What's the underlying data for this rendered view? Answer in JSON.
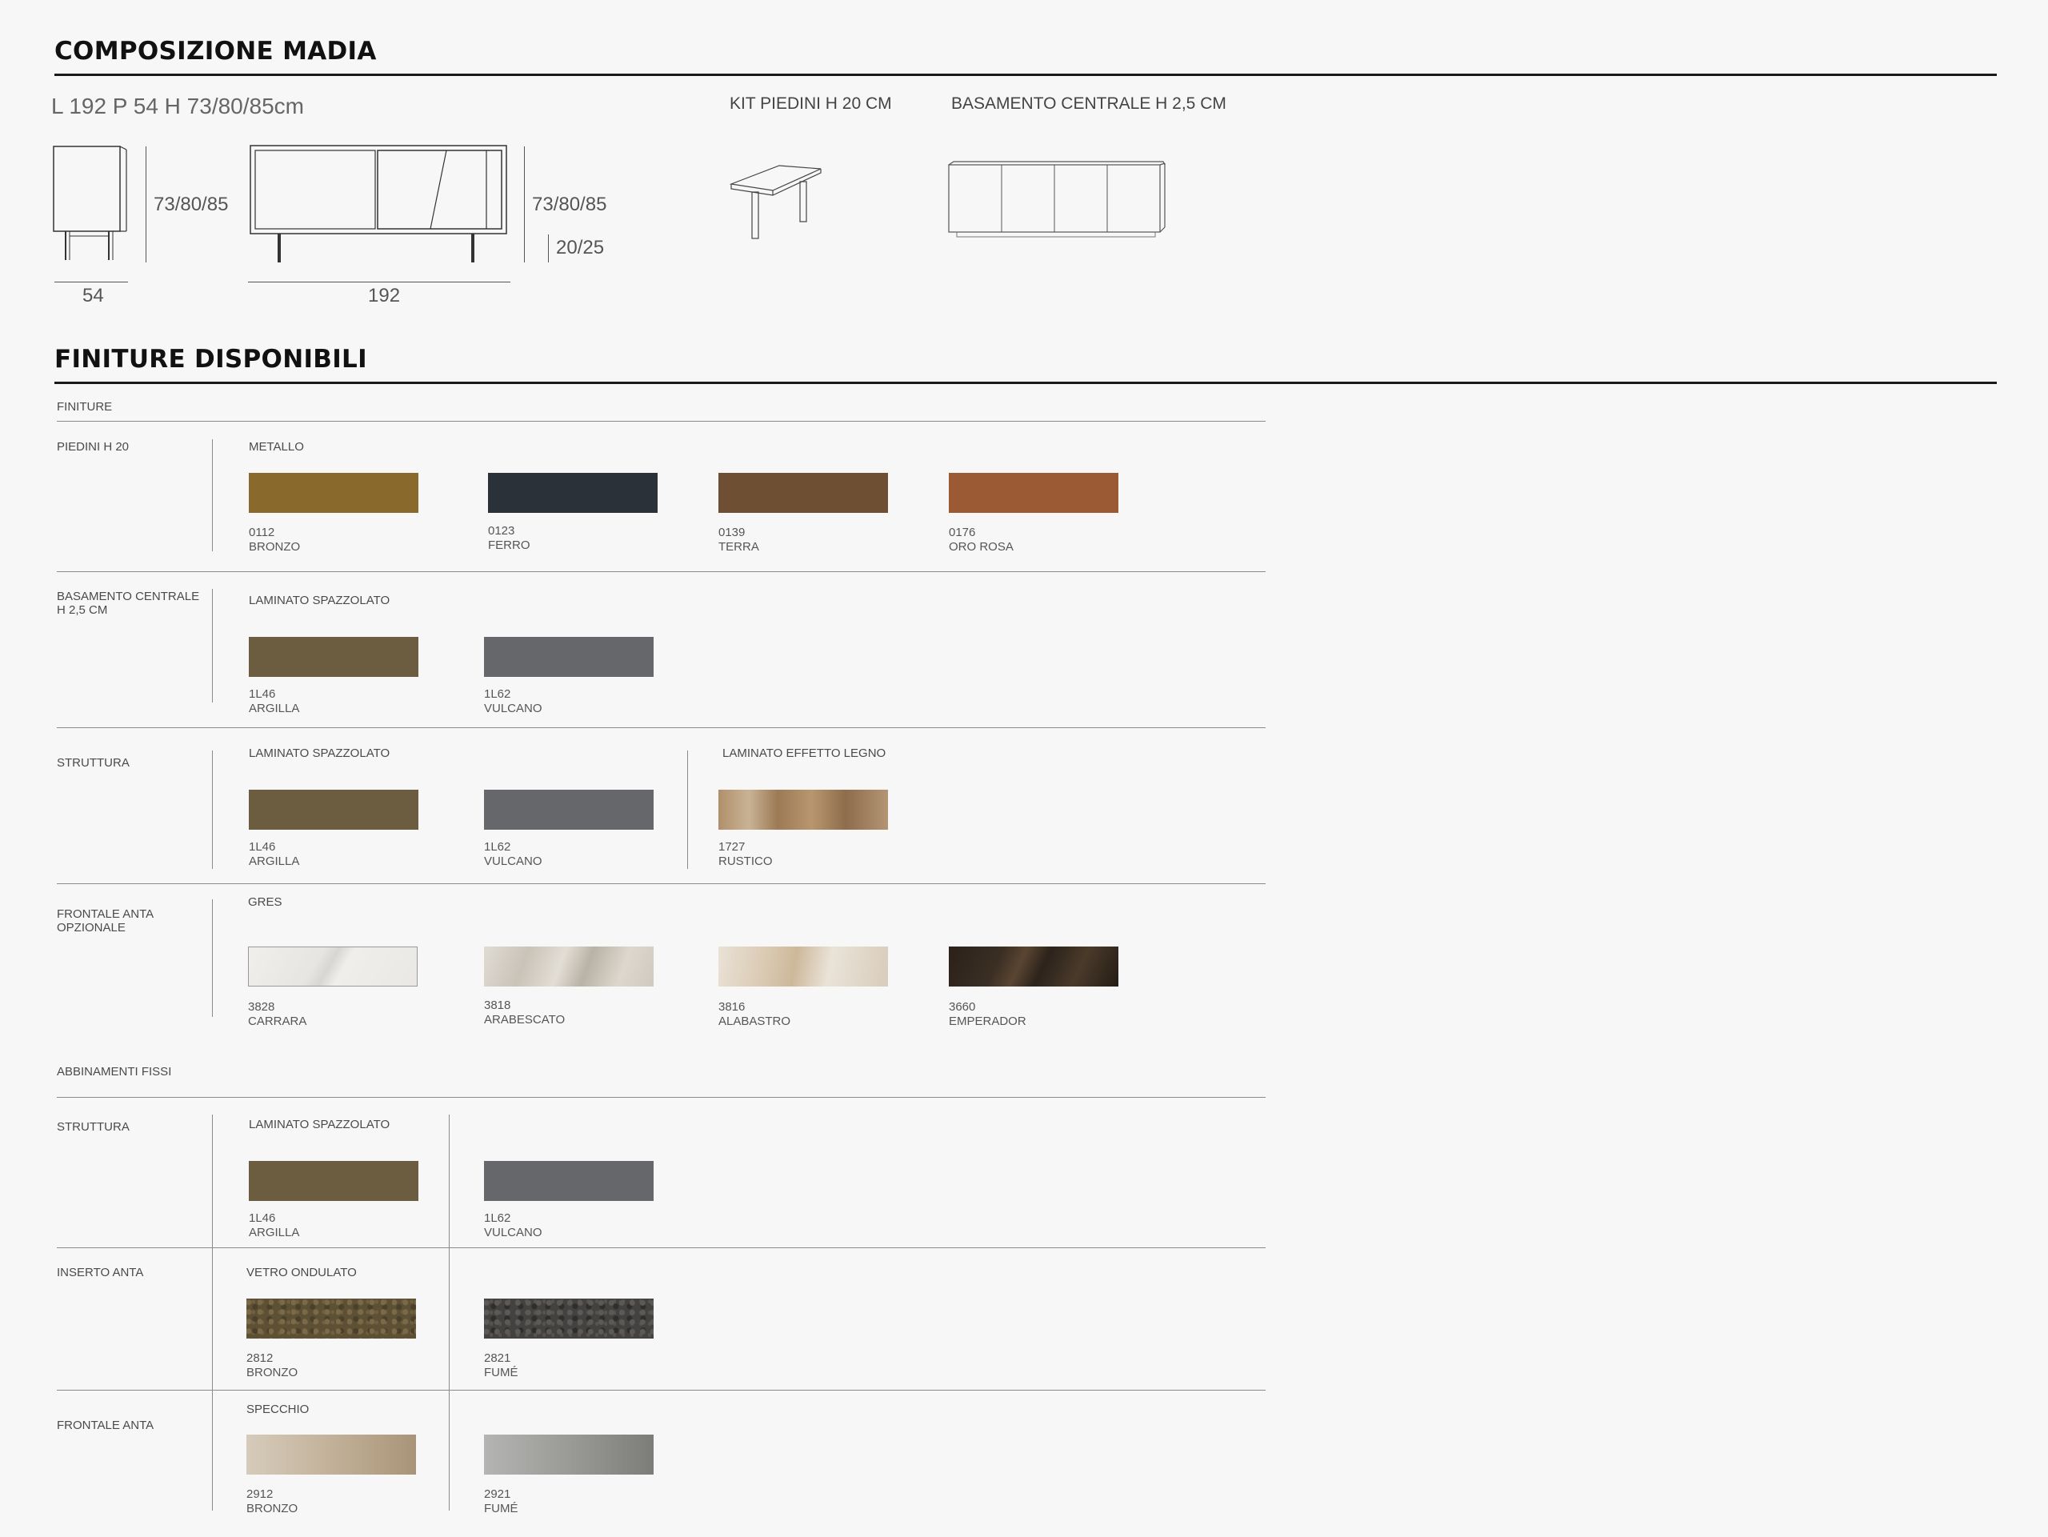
{
  "composizione": {
    "title": "COMPOSIZIONE MADIA",
    "dimensions": "L 192 P 54 H 73/80/85cm",
    "depth_label": "54",
    "height_label_side": "73/80/85",
    "width_label": "192",
    "height_label_front": "73/80/85",
    "feet_height_label": "20/25",
    "kit_piedini": "KIT PIEDINI H 20 CM",
    "basamento_centrale": "BASAMENTO CENTRALE H 2,5 CM"
  },
  "finiture": {
    "title": "FINITURE DISPONIBILI",
    "header": "FINITURE",
    "piedini": {
      "label": "PIEDINI H 20",
      "material": "METALLO",
      "swatches": [
        {
          "code": "0112",
          "name": "BRONZO",
          "color": "#8a6a2c"
        },
        {
          "code": "0123",
          "name": "FERRO",
          "color": "#2b3138"
        },
        {
          "code": "0139",
          "name": "TERRA",
          "color": "#6e4f34"
        },
        {
          "code": "0176",
          "name": "ORO ROSA",
          "color": "#9b5a34"
        }
      ]
    },
    "basamento": {
      "label_line1": "BASAMENTO CENTRALE",
      "label_line2": "H 2,5 CM",
      "material": "LAMINATO SPAZZOLATO",
      "swatches": [
        {
          "code": "1L46",
          "name": "ARGILLA",
          "color": "#6c5c40"
        },
        {
          "code": "1L62",
          "name": "VULCANO",
          "color": "#66676a"
        }
      ]
    },
    "struttura": {
      "label": "STRUTTURA",
      "material": "LAMINATO SPAZZOLATO",
      "material2": "LAMINATO EFFETTO LEGNO",
      "swatches": [
        {
          "code": "1L46",
          "name": "ARGILLA",
          "color": "#6c5c40"
        },
        {
          "code": "1L62",
          "name": "VULCANO",
          "color": "#66676a"
        },
        {
          "code": "1727",
          "name": "RUSTICO",
          "color": "#a5825f"
        }
      ]
    },
    "frontale_opzionale": {
      "label_line1": "FRONTALE ANTA",
      "label_line2": "OPZIONALE",
      "material": "GRES",
      "swatches": [
        {
          "code": "3828",
          "name": "CARRARA",
          "color": "#ecebe8"
        },
        {
          "code": "3818",
          "name": "ARABESCATO",
          "color": "#d7d1c7"
        },
        {
          "code": "3816",
          "name": "ALABASTRO",
          "color": "#ddd2c1"
        },
        {
          "code": "3660",
          "name": "EMPERADOR",
          "color": "#2f261e"
        }
      ]
    }
  },
  "abbinamenti": {
    "header": "ABBINAMENTI FISSI",
    "struttura": {
      "label": "STRUTTURA",
      "material": "LAMINATO SPAZZOLATO",
      "swatches": [
        {
          "code": "1L46",
          "name": "ARGILLA",
          "color": "#6c5c40"
        },
        {
          "code": "1L62",
          "name": "VULCANO",
          "color": "#66676a"
        }
      ]
    },
    "inserto": {
      "label": "INSERTO ANTA",
      "material": "VETRO ONDULATO",
      "swatches": [
        {
          "code": "2812",
          "name": "BRONZO",
          "color": "#5d5035"
        },
        {
          "code": "2821",
          "name": "FUMÉ",
          "color": "#434240"
        }
      ]
    },
    "frontale": {
      "label": "FRONTALE ANTA",
      "material": "SPECCHIO",
      "swatches": [
        {
          "code": "2912",
          "name": "BRONZO",
          "color": "#b8a58c"
        },
        {
          "code": "2921",
          "name": "FUMÉ",
          "color": "#8f8f8c"
        }
      ]
    }
  }
}
